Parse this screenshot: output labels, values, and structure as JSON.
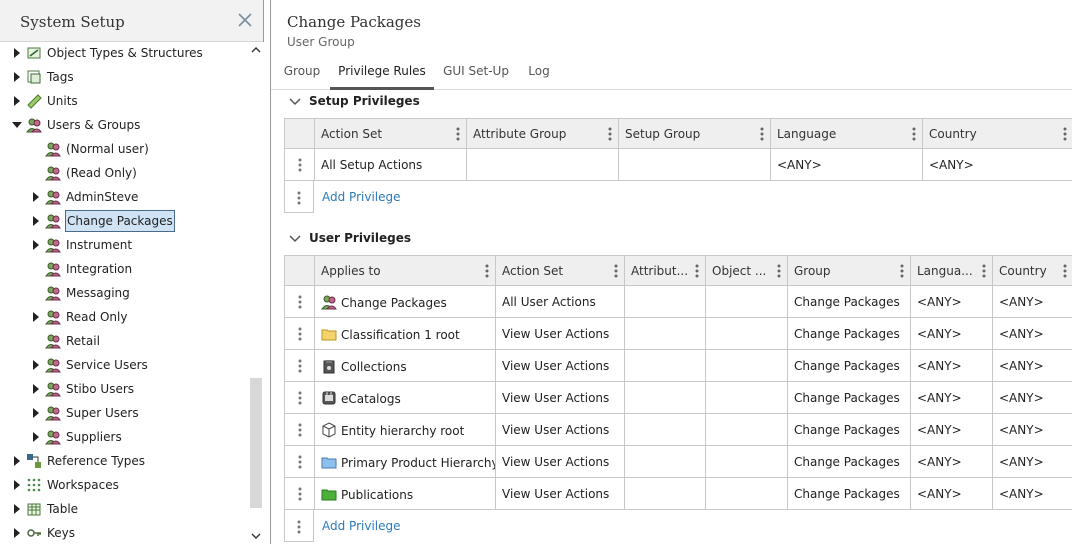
{
  "left_panel": {
    "title": "System Setup",
    "tree": [
      {
        "label": "Object Types & Structures",
        "icon": "object-types-icon",
        "level": 0,
        "expandable": true,
        "expanded": false
      },
      {
        "label": "Tags",
        "icon": "tags-icon",
        "level": 0,
        "expandable": true,
        "expanded": false
      },
      {
        "label": "Units",
        "icon": "ruler-icon",
        "level": 0,
        "expandable": true,
        "expanded": false
      },
      {
        "label": "Users & Groups",
        "icon": "users-group-icon",
        "level": 0,
        "expandable": true,
        "expanded": true
      },
      {
        "label": "(Normal user)",
        "icon": "user-group-icon",
        "level": 1,
        "expandable": false
      },
      {
        "label": "(Read Only)",
        "icon": "user-group-icon",
        "level": 1,
        "expandable": false
      },
      {
        "label": "AdminSteve",
        "icon": "user-group-icon",
        "level": 1,
        "expandable": true,
        "expanded": false
      },
      {
        "label": "Change Packages",
        "icon": "user-group-icon",
        "level": 1,
        "expandable": true,
        "expanded": false,
        "selected": true
      },
      {
        "label": "Instrument",
        "icon": "user-group-icon",
        "level": 1,
        "expandable": true,
        "expanded": false
      },
      {
        "label": "Integration",
        "icon": "user-group-icon",
        "level": 1,
        "expandable": false
      },
      {
        "label": "Messaging",
        "icon": "user-group-icon",
        "level": 1,
        "expandable": false
      },
      {
        "label": "Read Only",
        "icon": "user-group-icon",
        "level": 1,
        "expandable": true,
        "expanded": false
      },
      {
        "label": "Retail",
        "icon": "user-group-icon",
        "level": 1,
        "expandable": false
      },
      {
        "label": "Service Users",
        "icon": "user-group-icon",
        "level": 1,
        "expandable": true,
        "expanded": false
      },
      {
        "label": "Stibo Users",
        "icon": "user-group-icon",
        "level": 1,
        "expandable": true,
        "expanded": false
      },
      {
        "label": "Super Users",
        "icon": "user-group-icon",
        "level": 1,
        "expandable": true,
        "expanded": false
      },
      {
        "label": "Suppliers",
        "icon": "user-group-icon",
        "level": 1,
        "expandable": true,
        "expanded": false
      },
      {
        "label": "Reference Types",
        "icon": "reference-types-icon",
        "level": 0,
        "expandable": true,
        "expanded": false
      },
      {
        "label": "Workspaces",
        "icon": "workspaces-icon",
        "level": 0,
        "expandable": true,
        "expanded": false
      },
      {
        "label": "Table",
        "icon": "table-icon",
        "level": 0,
        "expandable": true,
        "expanded": false
      },
      {
        "label": "Keys",
        "icon": "keys-icon",
        "level": 0,
        "expandable": true,
        "expanded": false
      }
    ]
  },
  "right_panel": {
    "title": "Change Packages",
    "subtitle": "User Group",
    "tabs": [
      {
        "label": "Group",
        "active": false
      },
      {
        "label": "Privilege Rules",
        "active": true
      },
      {
        "label": "GUI Set-Up",
        "active": false
      },
      {
        "label": "Log",
        "active": false
      }
    ],
    "setup_privileges": {
      "heading": "Setup Privileges",
      "columns": [
        "Action Set",
        "Attribute Group",
        "Setup Group",
        "Language",
        "Country"
      ],
      "rows": [
        [
          "All Setup Actions",
          "",
          "",
          "<ANY>",
          "<ANY>"
        ]
      ],
      "add_label": "Add Privilege"
    },
    "user_privileges": {
      "heading": "User Privileges",
      "columns": [
        "Applies to",
        "Action Set",
        "Attribut...",
        "Object ...",
        "Group",
        "Langua...",
        "Country"
      ],
      "rows": [
        {
          "icon": "user-group-icon",
          "applies_to": "Change Packages",
          "action_set": "All User Actions",
          "attribute": "",
          "object": "",
          "group": "Change Packages",
          "language": "<ANY>",
          "country": "<ANY>"
        },
        {
          "icon": "folder-yellow-icon",
          "applies_to": "Classification 1 root",
          "action_set": "View User Actions",
          "attribute": "",
          "object": "",
          "group": "Change Packages",
          "language": "<ANY>",
          "country": "<ANY>"
        },
        {
          "icon": "collection-icon",
          "applies_to": "Collections",
          "action_set": "View User Actions",
          "attribute": "",
          "object": "",
          "group": "Change Packages",
          "language": "<ANY>",
          "country": "<ANY>"
        },
        {
          "icon": "ecatalog-icon",
          "applies_to": "eCatalogs",
          "action_set": "View User Actions",
          "attribute": "",
          "object": "",
          "group": "Change Packages",
          "language": "<ANY>",
          "country": "<ANY>"
        },
        {
          "icon": "cube-icon",
          "applies_to": "Entity hierarchy root",
          "action_set": "View User Actions",
          "attribute": "",
          "object": "",
          "group": "Change Packages",
          "language": "<ANY>",
          "country": "<ANY>"
        },
        {
          "icon": "folder-blue-icon",
          "applies_to": "Primary Product Hierarchy",
          "action_set": "View User Actions",
          "attribute": "",
          "object": "",
          "group": "Change Packages",
          "language": "<ANY>",
          "country": "<ANY>"
        },
        {
          "icon": "folder-green-icon",
          "applies_to": "Publications",
          "action_set": "View User Actions",
          "attribute": "",
          "object": "",
          "group": "Change Packages",
          "language": "<ANY>",
          "country": "<ANY>"
        }
      ],
      "add_label": "Add Privilege"
    }
  }
}
